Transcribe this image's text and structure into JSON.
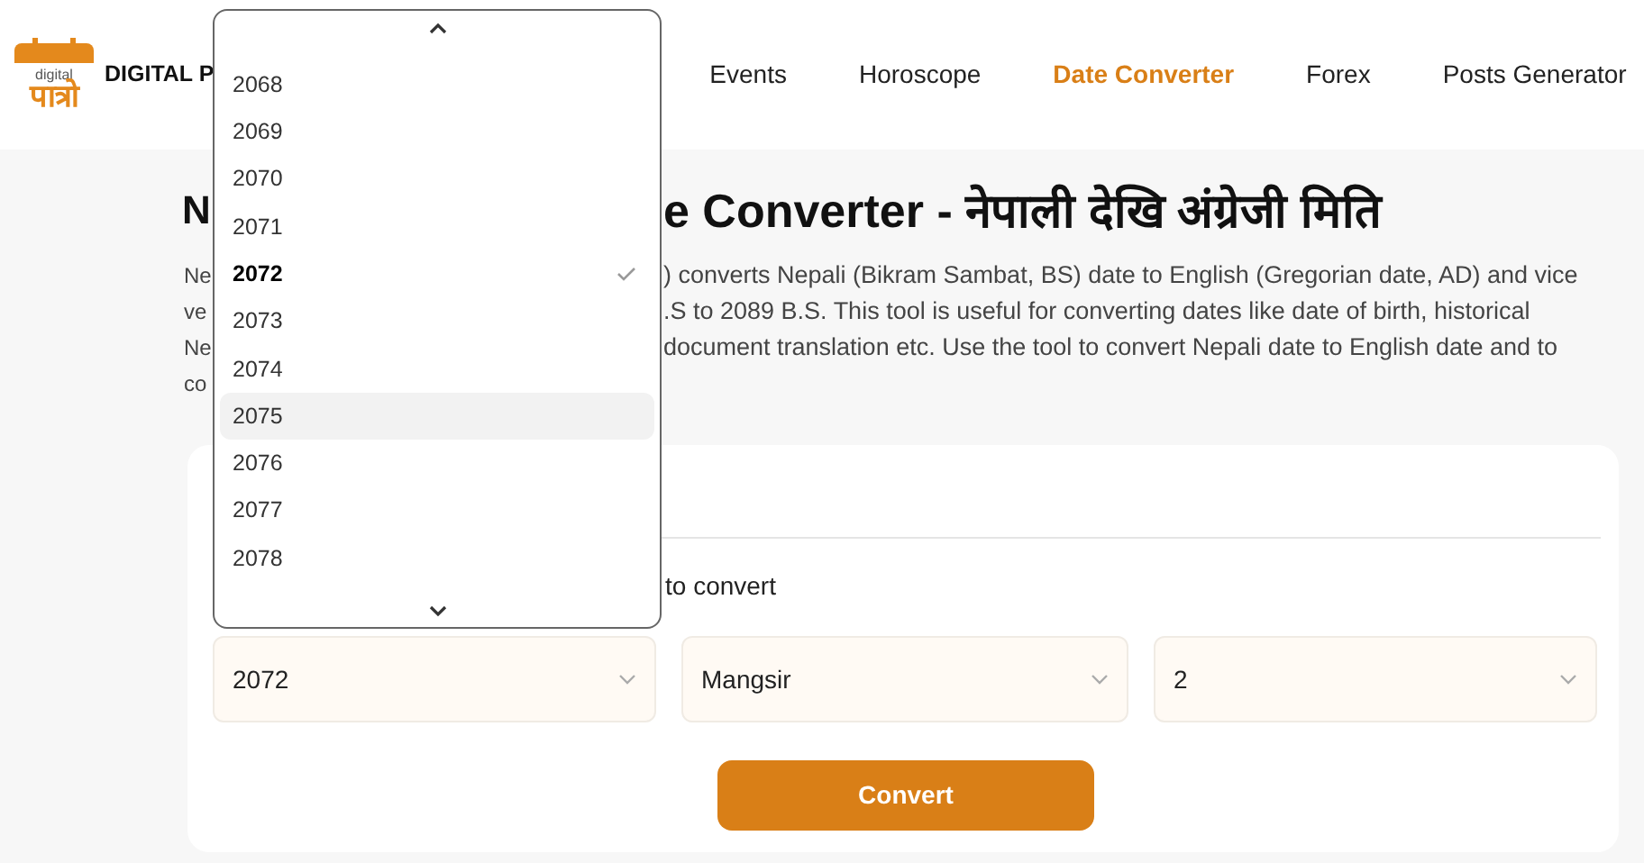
{
  "header": {
    "logo": {
      "small_text": "digital",
      "big_text": "पात्रो"
    },
    "brand": "DIGITAL P",
    "nav": [
      {
        "label": "Events",
        "selected": false
      },
      {
        "label": "Horoscope",
        "selected": false
      },
      {
        "label": "Date Converter",
        "selected": true
      },
      {
        "label": "Forex",
        "selected": false
      },
      {
        "label": "Posts Generator",
        "selected": false
      }
    ]
  },
  "heading": {
    "left": "N",
    "right": "e Converter - नेपाली देखि अंग्रेजी मिति"
  },
  "description_lines": [
    {
      "left": "Ne",
      "right": ") converts Nepali (Bikram Sambat, BS) date to English (Gregorian date, AD) and vice"
    },
    {
      "left": "ve",
      "right": ".S to 2089 B.S. This tool is useful for converting dates like date of birth, historical"
    },
    {
      "left": "Ne",
      "right": "document translation etc. Use the tool to convert Nepali date to English date and to"
    },
    {
      "left": "co"
    }
  ],
  "converter": {
    "instruction": "to convert",
    "selects": [
      {
        "value": "2072"
      },
      {
        "value": "Mangsir"
      },
      {
        "value": "2"
      }
    ],
    "button": "Convert"
  },
  "year_dropdown": {
    "options": [
      {
        "label": "2068",
        "selected": false,
        "highlighted": false
      },
      {
        "label": "2069",
        "selected": false,
        "highlighted": false
      },
      {
        "label": "2070",
        "selected": false,
        "highlighted": false
      },
      {
        "label": "2071",
        "selected": false,
        "highlighted": false
      },
      {
        "label": "2072",
        "selected": true,
        "highlighted": false
      },
      {
        "label": "2073",
        "selected": false,
        "highlighted": false
      },
      {
        "label": "2074",
        "selected": false,
        "highlighted": false
      },
      {
        "label": "2075",
        "selected": false,
        "highlighted": true
      },
      {
        "label": "2076",
        "selected": false,
        "highlighted": false
      },
      {
        "label": "2077",
        "selected": false,
        "highlighted": false
      },
      {
        "label": "2078",
        "selected": false,
        "highlighted": false
      }
    ]
  }
}
